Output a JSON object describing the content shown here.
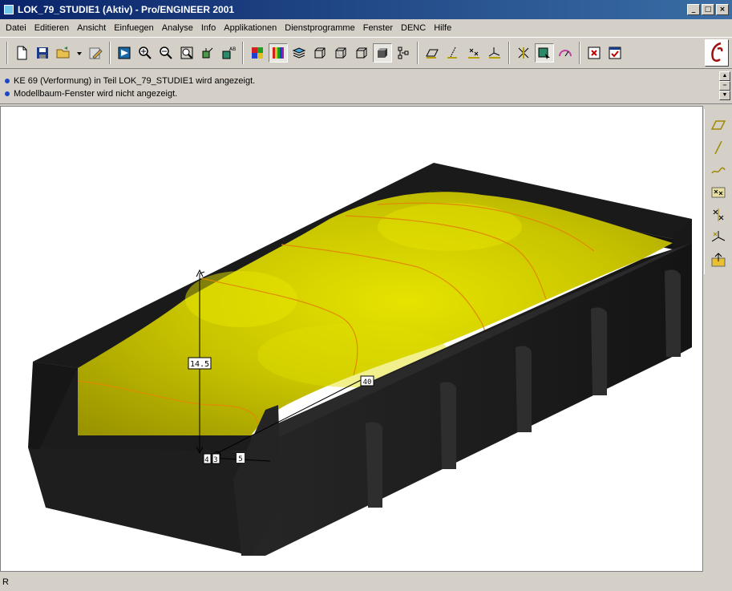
{
  "window": {
    "title": "LOK_79_STUDIE1 (Aktiv) - Pro/ENGINEER 2001",
    "minimize": "_",
    "maximize": "□",
    "close": "×"
  },
  "menu": [
    "Datei",
    "Editieren",
    "Ansicht",
    "Einfuegen",
    "Analyse",
    "Info",
    "Applikationen",
    "Dienstprogramme",
    "Fenster",
    "DENC",
    "Hilfe"
  ],
  "toolbar": {
    "big_icon": "pro-engineer-logo-icon",
    "groups": [
      [
        "new-file-icon",
        "save-icon",
        "open-folder-icon",
        "dropdown-arrow-icon",
        "edit-sketch-icon"
      ],
      [
        "repaint-icon",
        "zoom-in-icon",
        "zoom-out-icon",
        "zoom-window-icon",
        "orient-icon",
        "saved-views-icon"
      ],
      [
        "color-palette-icon",
        "model-colors-icon",
        "layers-icon",
        "wireframe-icon",
        "hidden-line-icon",
        "no-hidden-icon",
        "shaded-icon",
        "model-tree-icon"
      ],
      [
        "datum-planes-icon",
        "datum-axes-icon",
        "datum-points-icon",
        "coordinate-system-icon"
      ],
      [
        "spin-center-icon",
        "select-icon",
        "measure-icon"
      ],
      [
        "close-window-icon",
        "activate-window-icon"
      ]
    ]
  },
  "messages": [
    "KE 69 (Verformung) in Teil LOK_79_STUDIE1 wird angezeigt.",
    "Modellbaum-Fenster wird nicht angezeigt."
  ],
  "viewport": {
    "dimensions": [
      "14.5",
      "40",
      "5",
      "4",
      "3"
    ],
    "colors": {
      "surface": "#c8c400",
      "surface_light": "#e6e300",
      "box": "#1e1e1e",
      "box_dark": "#0e0e0e",
      "curve": "#e08a00"
    }
  },
  "right_toolbar": [
    "datum-plane-tool-icon",
    "datum-axis-tool-icon",
    "datum-curve-tool-icon",
    "datum-point-tool-icon",
    "sketched-datum-icon",
    "coordinate-system-tool-icon",
    "analysis-feature-icon"
  ],
  "status": {
    "text": "R"
  }
}
